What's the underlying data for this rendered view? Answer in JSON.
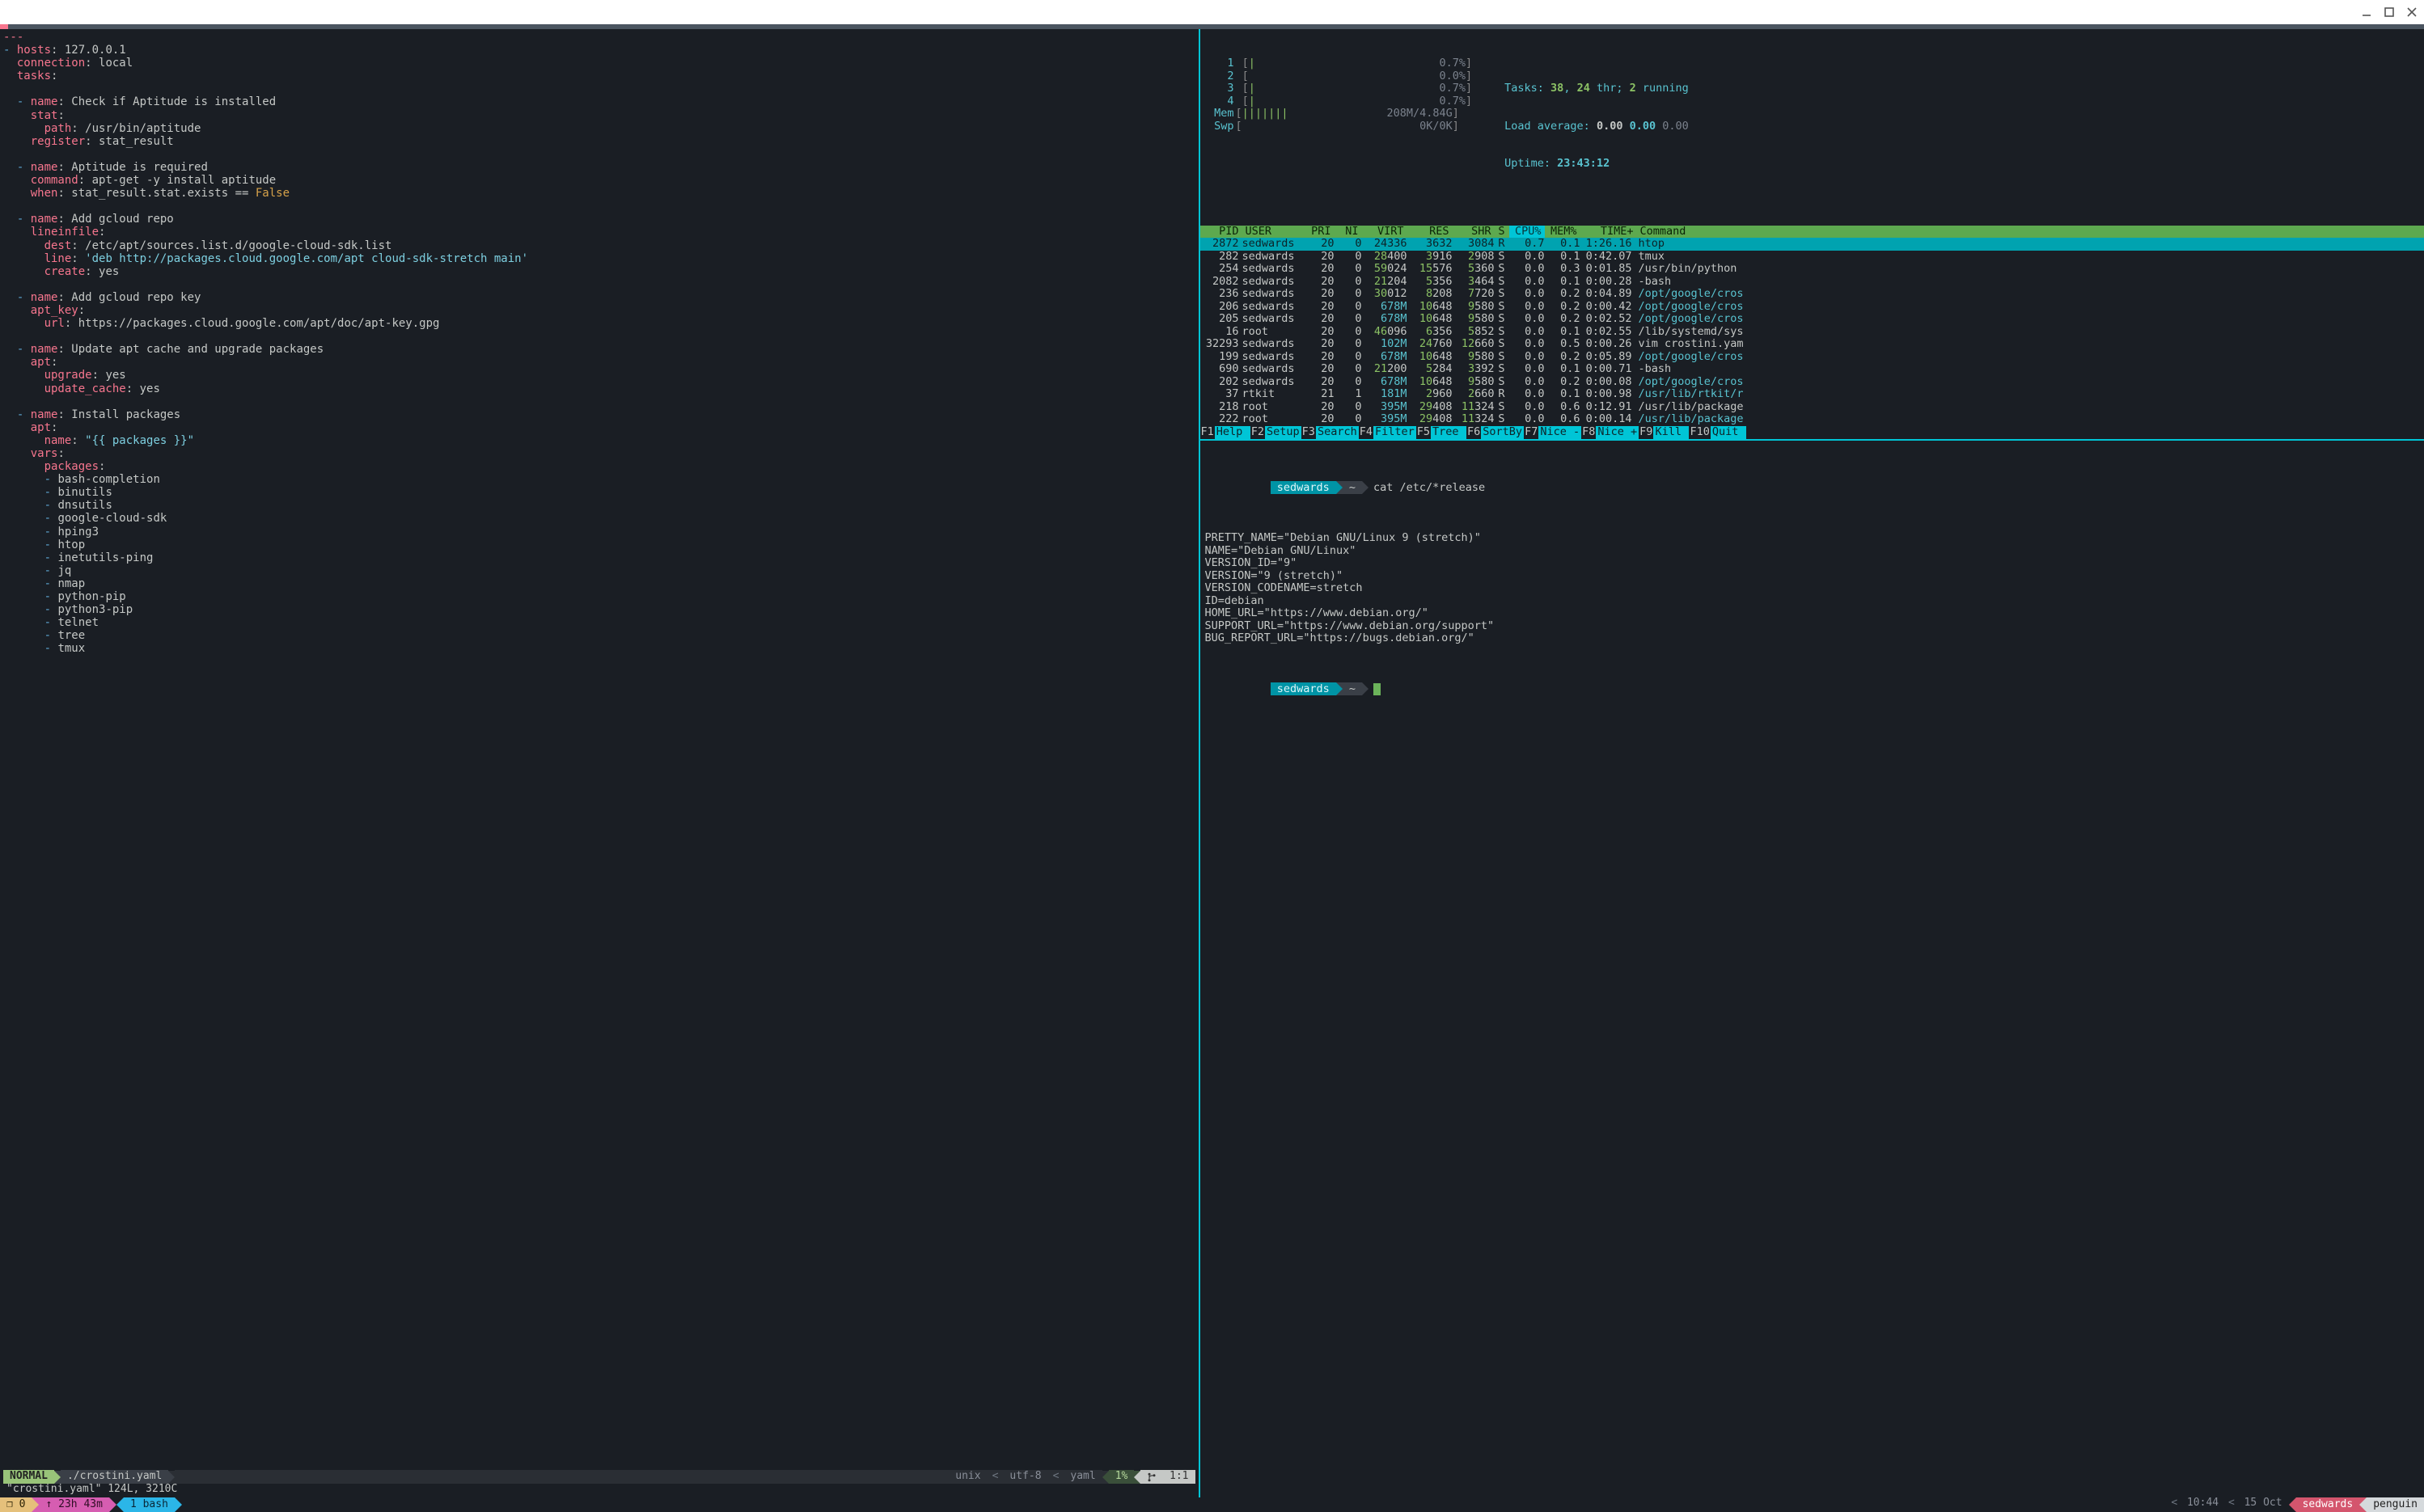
{
  "titlebar": {
    "min": "minimize",
    "max": "maximize",
    "close": "close"
  },
  "vim": {
    "lines": [
      {
        "t": "---",
        "cls": "r"
      },
      {
        "segs": [
          {
            "t": "- ",
            "cls": "b"
          },
          {
            "t": "hosts",
            "cls": "r"
          },
          {
            "t": ": 127.0.0.1",
            "cls": "w"
          }
        ]
      },
      {
        "segs": [
          {
            "t": "  ",
            "cls": "w"
          },
          {
            "t": "connection",
            "cls": "r"
          },
          {
            "t": ": local",
            "cls": "w"
          }
        ]
      },
      {
        "segs": [
          {
            "t": "  ",
            "cls": "w"
          },
          {
            "t": "tasks",
            "cls": "r"
          },
          {
            "t": ":",
            "cls": "w"
          }
        ]
      },
      {
        "t": " "
      },
      {
        "segs": [
          {
            "t": "  - ",
            "cls": "b"
          },
          {
            "t": "name",
            "cls": "r"
          },
          {
            "t": ": Check if Aptitude is installed",
            "cls": "w"
          }
        ]
      },
      {
        "segs": [
          {
            "t": "    ",
            "cls": "w"
          },
          {
            "t": "stat",
            "cls": "r"
          },
          {
            "t": ":",
            "cls": "w"
          }
        ]
      },
      {
        "segs": [
          {
            "t": "      ",
            "cls": "w"
          },
          {
            "t": "path",
            "cls": "r"
          },
          {
            "t": ": /usr/bin/aptitude",
            "cls": "w"
          }
        ]
      },
      {
        "segs": [
          {
            "t": "    ",
            "cls": "w"
          },
          {
            "t": "register",
            "cls": "r"
          },
          {
            "t": ": stat_result",
            "cls": "w"
          }
        ]
      },
      {
        "t": " "
      },
      {
        "segs": [
          {
            "t": "  - ",
            "cls": "b"
          },
          {
            "t": "name",
            "cls": "r"
          },
          {
            "t": ": Aptitude is required",
            "cls": "w"
          }
        ]
      },
      {
        "segs": [
          {
            "t": "    ",
            "cls": "w"
          },
          {
            "t": "command",
            "cls": "r"
          },
          {
            "t": ": apt-get -y install aptitude",
            "cls": "w"
          }
        ]
      },
      {
        "segs": [
          {
            "t": "    ",
            "cls": "w"
          },
          {
            "t": "when",
            "cls": "r"
          },
          {
            "t": ": stat_result.stat.exists == ",
            "cls": "w"
          },
          {
            "t": "False",
            "cls": "y"
          }
        ]
      },
      {
        "t": " "
      },
      {
        "segs": [
          {
            "t": "  - ",
            "cls": "b"
          },
          {
            "t": "name",
            "cls": "r"
          },
          {
            "t": ": Add gcloud repo",
            "cls": "w"
          }
        ]
      },
      {
        "segs": [
          {
            "t": "    ",
            "cls": "w"
          },
          {
            "t": "lineinfile",
            "cls": "r"
          },
          {
            "t": ":",
            "cls": "w"
          }
        ]
      },
      {
        "segs": [
          {
            "t": "      ",
            "cls": "w"
          },
          {
            "t": "dest",
            "cls": "r"
          },
          {
            "t": ": /etc/apt/sources.list.d/google-cloud-sdk.list",
            "cls": "w"
          }
        ]
      },
      {
        "segs": [
          {
            "t": "      ",
            "cls": "w"
          },
          {
            "t": "line",
            "cls": "r"
          },
          {
            "t": ": ",
            "cls": "w"
          },
          {
            "t": "'deb http://packages.cloud.google.com/apt cloud-sdk-stretch main'",
            "cls": "c"
          }
        ]
      },
      {
        "segs": [
          {
            "t": "      ",
            "cls": "w"
          },
          {
            "t": "create",
            "cls": "r"
          },
          {
            "t": ": yes",
            "cls": "w"
          }
        ]
      },
      {
        "t": " "
      },
      {
        "segs": [
          {
            "t": "  - ",
            "cls": "b"
          },
          {
            "t": "name",
            "cls": "r"
          },
          {
            "t": ": Add gcloud repo key",
            "cls": "w"
          }
        ]
      },
      {
        "segs": [
          {
            "t": "    ",
            "cls": "w"
          },
          {
            "t": "apt_key",
            "cls": "r"
          },
          {
            "t": ":",
            "cls": "w"
          }
        ]
      },
      {
        "segs": [
          {
            "t": "      ",
            "cls": "w"
          },
          {
            "t": "url",
            "cls": "r"
          },
          {
            "t": ": https://packages.cloud.google.com/apt/doc/apt-key.gpg",
            "cls": "w"
          }
        ]
      },
      {
        "t": " "
      },
      {
        "segs": [
          {
            "t": "  - ",
            "cls": "b"
          },
          {
            "t": "name",
            "cls": "r"
          },
          {
            "t": ": Update apt cache and upgrade packages",
            "cls": "w"
          }
        ]
      },
      {
        "segs": [
          {
            "t": "    ",
            "cls": "w"
          },
          {
            "t": "apt",
            "cls": "r"
          },
          {
            "t": ":",
            "cls": "w"
          }
        ]
      },
      {
        "segs": [
          {
            "t": "      ",
            "cls": "w"
          },
          {
            "t": "upgrade",
            "cls": "r"
          },
          {
            "t": ": yes",
            "cls": "w"
          }
        ]
      },
      {
        "segs": [
          {
            "t": "      ",
            "cls": "w"
          },
          {
            "t": "update_cache",
            "cls": "r"
          },
          {
            "t": ": yes",
            "cls": "w"
          }
        ]
      },
      {
        "t": " "
      },
      {
        "segs": [
          {
            "t": "  - ",
            "cls": "b"
          },
          {
            "t": "name",
            "cls": "r"
          },
          {
            "t": ": Install packages",
            "cls": "w"
          }
        ]
      },
      {
        "segs": [
          {
            "t": "    ",
            "cls": "w"
          },
          {
            "t": "apt",
            "cls": "r"
          },
          {
            "t": ":",
            "cls": "w"
          }
        ]
      },
      {
        "segs": [
          {
            "t": "      ",
            "cls": "w"
          },
          {
            "t": "name",
            "cls": "r"
          },
          {
            "t": ": ",
            "cls": "w"
          },
          {
            "t": "\"{{ packages }}\"",
            "cls": "c"
          }
        ]
      },
      {
        "segs": [
          {
            "t": "    ",
            "cls": "w"
          },
          {
            "t": "vars",
            "cls": "r"
          },
          {
            "t": ":",
            "cls": "w"
          }
        ]
      },
      {
        "segs": [
          {
            "t": "      ",
            "cls": "w"
          },
          {
            "t": "packages",
            "cls": "r"
          },
          {
            "t": ":",
            "cls": "w"
          }
        ]
      },
      {
        "segs": [
          {
            "t": "      - ",
            "cls": "b"
          },
          {
            "t": "bash-completion",
            "cls": "w"
          }
        ]
      },
      {
        "segs": [
          {
            "t": "      - ",
            "cls": "b"
          },
          {
            "t": "binutils",
            "cls": "w"
          }
        ]
      },
      {
        "segs": [
          {
            "t": "      - ",
            "cls": "b"
          },
          {
            "t": "dnsutils",
            "cls": "w"
          }
        ]
      },
      {
        "segs": [
          {
            "t": "      - ",
            "cls": "b"
          },
          {
            "t": "google-cloud-sdk",
            "cls": "w"
          }
        ]
      },
      {
        "segs": [
          {
            "t": "      - ",
            "cls": "b"
          },
          {
            "t": "hping3",
            "cls": "w"
          }
        ]
      },
      {
        "segs": [
          {
            "t": "      - ",
            "cls": "b"
          },
          {
            "t": "htop",
            "cls": "w"
          }
        ]
      },
      {
        "segs": [
          {
            "t": "      - ",
            "cls": "b"
          },
          {
            "t": "inetutils-ping",
            "cls": "w"
          }
        ]
      },
      {
        "segs": [
          {
            "t": "      - ",
            "cls": "b"
          },
          {
            "t": "jq",
            "cls": "w"
          }
        ]
      },
      {
        "segs": [
          {
            "t": "      - ",
            "cls": "b"
          },
          {
            "t": "nmap",
            "cls": "w"
          }
        ]
      },
      {
        "segs": [
          {
            "t": "      - ",
            "cls": "b"
          },
          {
            "t": "python-pip",
            "cls": "w"
          }
        ]
      },
      {
        "segs": [
          {
            "t": "      - ",
            "cls": "b"
          },
          {
            "t": "python3-pip",
            "cls": "w"
          }
        ]
      },
      {
        "segs": [
          {
            "t": "      - ",
            "cls": "b"
          },
          {
            "t": "telnet",
            "cls": "w"
          }
        ]
      },
      {
        "segs": [
          {
            "t": "      - ",
            "cls": "b"
          },
          {
            "t": "tree",
            "cls": "w"
          }
        ]
      },
      {
        "segs": [
          {
            "t": "      - ",
            "cls": "b"
          },
          {
            "t": "tmux",
            "cls": "w"
          }
        ]
      }
    ],
    "mode": " NORMAL ",
    "file": "./crostini.yaml",
    "meta_unix": "unix",
    "meta_enc": "utf-8",
    "meta_ft": "yaml",
    "percent": "1%",
    "linecol": "1:1",
    "cmd": "\"crostini.yaml\" 124L, 3210C"
  },
  "htop": {
    "cpus": [
      {
        "n": "1",
        "bar": "|",
        "val": "0.7%"
      },
      {
        "n": "2",
        "bar": "",
        "val": "0.0%"
      },
      {
        "n": "3",
        "bar": "|",
        "val": "0.7%"
      },
      {
        "n": "4",
        "bar": "|",
        "val": "0.7%"
      }
    ],
    "mem": {
      "label": "Mem",
      "bar": "|||||||",
      "val": "208M/4.84G"
    },
    "swp": {
      "label": "Swp",
      "bar": "",
      "val": "0K/0K"
    },
    "tasks": {
      "label": "Tasks: ",
      "v1": "38",
      "sep": ", ",
      "v2": "24",
      "thr": " thr; ",
      "v3": "2",
      "run": " running"
    },
    "load": {
      "label": "Load average: ",
      "a": "0.00",
      "b": "0.00",
      "c": "0.00"
    },
    "uptime": {
      "label": "Uptime: ",
      "v": "23:43:12"
    },
    "hdr": [
      "PID",
      "USER",
      "PRI",
      "NI",
      "VIRT",
      "RES",
      "SHR",
      "S",
      "CPU%",
      "MEM%",
      "TIME+",
      "Command"
    ],
    "rows": [
      {
        "sel": true,
        "pid": "2872",
        "user": "sedwards",
        "pri": "20",
        "ni": "0",
        "virt": "24336",
        "res": "3632",
        "shr": "3084",
        "s": "R",
        "cpu": "0.7",
        "mem": "0.1",
        "time": "1:26.16",
        "cmd": "htop"
      },
      {
        "pid": "282",
        "user": "sedwards",
        "pri": "20",
        "ni": "0",
        "virt": "28400",
        "virtg": "28",
        "res": "3916",
        "resg": "3",
        "shr": "2908",
        "shrg": "2",
        "s": "S",
        "cpu": "0.0",
        "mem": "0.1",
        "time": "0:42.07",
        "cmd": "tmux"
      },
      {
        "pid": "254",
        "user": "sedwards",
        "pri": "20",
        "ni": "0",
        "virt": "59024",
        "virtg": "59",
        "res": "15576",
        "resg": "15",
        "shr": "5360",
        "shrg": "5",
        "s": "S",
        "cpu": "0.0",
        "mem": "0.3",
        "time": "0:01.85",
        "cmd": "/usr/bin/python"
      },
      {
        "pid": "2082",
        "user": "sedwards",
        "pri": "20",
        "ni": "0",
        "virt": "21204",
        "virtg": "21",
        "res": "5356",
        "resg": "5",
        "shr": "3464",
        "shrg": "3",
        "s": "S",
        "cpu": "0.0",
        "mem": "0.1",
        "time": "0:00.28",
        "cmd": "-bash"
      },
      {
        "pid": "236",
        "user": "sedwards",
        "pri": "20",
        "ni": "0",
        "virt": "30012",
        "virtg": "30",
        "res": "8208",
        "resg": "8",
        "shr": "7720",
        "shrg": "7",
        "s": "S",
        "cpu": "0.0",
        "mem": "0.2",
        "time": "0:04.89",
        "cmd": "/opt/google/cros",
        "cmdc": true
      },
      {
        "pid": "206",
        "user": "sedwards",
        "pri": "20",
        "ni": "0",
        "virt": "678M",
        "virtc": true,
        "res": "10648",
        "resg": "10",
        "shr": "9580",
        "shrg": "9",
        "s": "S",
        "cpu": "0.0",
        "mem": "0.2",
        "time": "0:00.42",
        "cmd": "/opt/google/cros",
        "cmdc": true
      },
      {
        "pid": "205",
        "user": "sedwards",
        "pri": "20",
        "ni": "0",
        "virt": "678M",
        "virtc": true,
        "res": "10648",
        "resg": "10",
        "shr": "9580",
        "shrg": "9",
        "s": "S",
        "cpu": "0.0",
        "mem": "0.2",
        "time": "0:02.52",
        "cmd": "/opt/google/cros",
        "cmdc": true
      },
      {
        "pid": "16",
        "user": "root",
        "pri": "20",
        "ni": "0",
        "virt": "46096",
        "virtg": "46",
        "res": "6356",
        "resg": "6",
        "shr": "5852",
        "shrg": "5",
        "s": "S",
        "cpu": "0.0",
        "mem": "0.1",
        "time": "0:02.55",
        "cmd": "/lib/systemd/sys"
      },
      {
        "pid": "32293",
        "user": "sedwards",
        "pri": "20",
        "ni": "0",
        "virt": "102M",
        "virtc": true,
        "res": "24760",
        "resg": "24",
        "shr": "12660",
        "shrg": "12",
        "s": "S",
        "cpu": "0.0",
        "mem": "0.5",
        "time": "0:00.26",
        "cmd": "vim crostini.yam"
      },
      {
        "pid": "199",
        "user": "sedwards",
        "pri": "20",
        "ni": "0",
        "virt": "678M",
        "virtc": true,
        "res": "10648",
        "resg": "10",
        "shr": "9580",
        "shrg": "9",
        "s": "S",
        "cpu": "0.0",
        "mem": "0.2",
        "time": "0:05.89",
        "cmd": "/opt/google/cros",
        "cmdc": true
      },
      {
        "pid": "690",
        "user": "sedwards",
        "pri": "20",
        "ni": "0",
        "virt": "21200",
        "virtg": "21",
        "res": "5284",
        "resg": "5",
        "shr": "3392",
        "shrg": "3",
        "s": "S",
        "cpu": "0.0",
        "mem": "0.1",
        "time": "0:00.71",
        "cmd": "-bash"
      },
      {
        "pid": "202",
        "user": "sedwards",
        "pri": "20",
        "ni": "0",
        "virt": "678M",
        "virtc": true,
        "res": "10648",
        "resg": "10",
        "shr": "9580",
        "shrg": "9",
        "s": "S",
        "cpu": "0.0",
        "mem": "0.2",
        "time": "0:00.08",
        "cmd": "/opt/google/cros",
        "cmdc": true
      },
      {
        "pid": "37",
        "user": "rtkit",
        "pri": "21",
        "ni": "1",
        "virt": "181M",
        "virtc": true,
        "res": "2960",
        "resg": "2",
        "shr": "2660",
        "shrg": "2",
        "s": "R",
        "cpu": "0.0",
        "mem": "0.1",
        "time": "0:00.98",
        "cmd": "/usr/lib/rtkit/r",
        "cmdc": true
      },
      {
        "pid": "218",
        "user": "root",
        "pri": "20",
        "ni": "0",
        "virt": "395M",
        "virtc": true,
        "res": "29408",
        "resg": "29",
        "shr": "11324",
        "shrg": "11",
        "s": "S",
        "cpu": "0.0",
        "mem": "0.6",
        "time": "0:12.91",
        "cmd": "/usr/lib/package"
      },
      {
        "pid": "222",
        "user": "root",
        "pri": "20",
        "ni": "0",
        "virt": "395M",
        "virtc": true,
        "res": "29408",
        "resg": "29",
        "shr": "11324",
        "shrg": "11",
        "s": "S",
        "cpu": "0.0",
        "mem": "0.6",
        "time": "0:00.14",
        "cmd": "/usr/lib/package",
        "cmdc": true
      }
    ],
    "fkeys": [
      {
        "f": "F1",
        "l": "Help "
      },
      {
        "f": "F2",
        "l": "Setup "
      },
      {
        "f": "F3",
        "l": "Search"
      },
      {
        "f": "F4",
        "l": "Filter"
      },
      {
        "f": "F5",
        "l": "Tree "
      },
      {
        "f": "F6",
        "l": "SortBy"
      },
      {
        "f": "F7",
        "l": "Nice -"
      },
      {
        "f": "F8",
        "l": "Nice +"
      },
      {
        "f": "F9",
        "l": "Kill "
      },
      {
        "f": "F10",
        "l": "Quit"
      }
    ]
  },
  "shell": {
    "user": "sedwards",
    "path": "~",
    "cmd": "cat /etc/*release",
    "output": [
      "PRETTY_NAME=\"Debian GNU/Linux 9 (stretch)\"",
      "NAME=\"Debian GNU/Linux\"",
      "VERSION_ID=\"9\"",
      "VERSION=\"9 (stretch)\"",
      "VERSION_CODENAME=stretch",
      "ID=debian",
      "HOME_URL=\"https://www.debian.org/\"",
      "SUPPORT_URL=\"https://www.debian.org/support\"",
      "BUG_REPORT_URL=\"https://bugs.debian.org/\""
    ]
  },
  "tmux": {
    "session": "❐ 0",
    "uptime": "↑ 23h 43m",
    "window": "1 bash",
    "clock": "10:44",
    "date": "15 Oct",
    "user": "sedwards",
    "host": "penguin"
  }
}
